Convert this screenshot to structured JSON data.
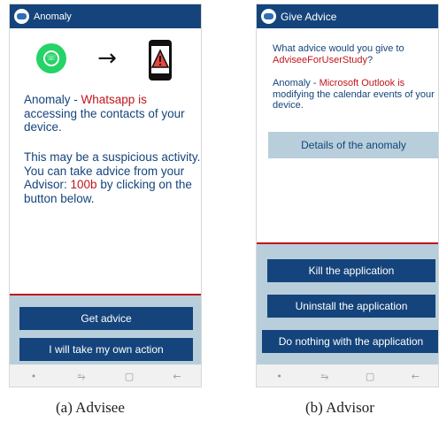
{
  "advisee": {
    "title": "Anomaly",
    "icons": {
      "app": "app-icon",
      "source": "whatsapp-icon",
      "arrow": "right-arrow-icon",
      "target": "phone-alert-icon"
    },
    "message1": {
      "prefix": "Anomaly - ",
      "highlight": "Whatsapp is",
      "rest": "accessing the contacts of your device."
    },
    "message2": {
      "text": "This may be a suspicious activity. You can take advice from your Advisor: ",
      "advisor": "100b",
      "suffix": " by clicking on the button below."
    },
    "buttons": {
      "get_advice": "Get advice",
      "own_action": "I will take my own action"
    },
    "caption": "(a)  Advisee"
  },
  "advisor": {
    "title": "Give Advice",
    "question": {
      "text": "What advice would you give to ",
      "user": "AdviseeForUserStudy",
      "suffix": "?"
    },
    "anomaly": {
      "prefix": "Anomaly - ",
      "highlight": "Microsoft Outlook is",
      "rest": "modifying the calendar events of your device."
    },
    "details_button": "Details of the anomaly",
    "buttons": {
      "kill": "Kill the application",
      "uninstall": "Uninstall the application",
      "nothing": "Do nothing with the application"
    },
    "caption": "(b)  Advisor"
  },
  "navbar": {
    "dot": "•",
    "recent": "⥱",
    "home": "▢",
    "back": "←"
  },
  "colors": {
    "primary": "#14447b",
    "accent_red": "#c0161c",
    "panel": "#b8cedb",
    "whatsapp": "#25d366"
  }
}
